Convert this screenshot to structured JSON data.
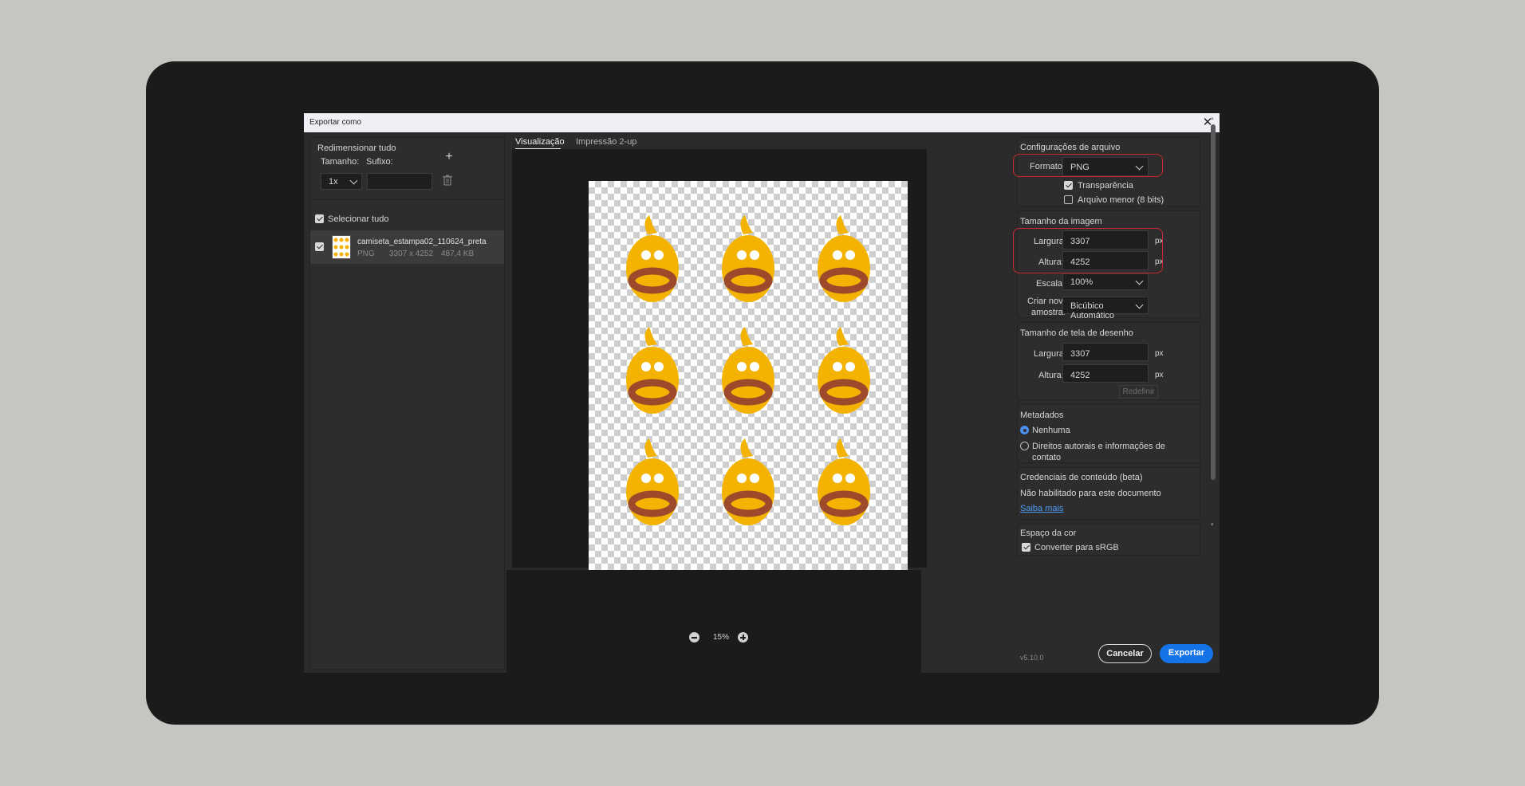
{
  "dialog": {
    "title": "Exportar como",
    "version": "v5.10.0"
  },
  "left": {
    "resize_all": "Redimensionar tudo",
    "size_label": "Tamanho:",
    "suffix_label": "Sufixo:",
    "size_value": "1x",
    "suffix_value": "",
    "select_all": "Selecionar tudo",
    "asset": {
      "name": "camiseta_estampa02_110624_preta",
      "format": "PNG",
      "dimensions": "3307 x 4252",
      "filesize": "487,4 KB"
    }
  },
  "center": {
    "tabs": [
      {
        "label": "Visualização",
        "active": true
      },
      {
        "label": "Impressão 2-up",
        "active": false
      }
    ],
    "zoom": "15%",
    "preview": {
      "mascot_color": "#f4b301",
      "mouth_color": "#9c4a2b",
      "cols": 3,
      "rows": 3
    }
  },
  "right": {
    "file_settings": {
      "heading": "Configurações de arquivo",
      "format_label": "Formato:",
      "format_value": "PNG",
      "transparency": "Transparência",
      "smaller_file": "Arquivo menor (8 bits)"
    },
    "image_size": {
      "heading": "Tamanho da imagem",
      "width_label": "Largura:",
      "width_value": "3307",
      "height_label": "Altura:",
      "height_value": "4252",
      "unit": "px",
      "scale_label": "Escala:",
      "scale_value": "100%",
      "resample_label_1": "Criar nova",
      "resample_label_2": "amostra:",
      "resample_value": "Bicúbico Automático"
    },
    "canvas_size": {
      "heading": "Tamanho de tela de desenho",
      "width_label": "Largura:",
      "width_value": "3307",
      "height_label": "Altura:",
      "height_value": "4252",
      "unit": "px",
      "reset": "Redefinir"
    },
    "metadata": {
      "heading": "Metadados",
      "option_none": "Nenhuma",
      "option_copyright_1": "Direitos autorais e informações de",
      "option_copyright_2": "contato"
    },
    "credentials": {
      "heading": "Credenciais de conteúdo (beta)",
      "status": "Não habilitado para este documento",
      "learn_more": "Saiba mais"
    },
    "color_space": {
      "heading": "Espaço da cor",
      "convert": "Converter para sRGB"
    }
  },
  "buttons": {
    "cancel": "Cancelar",
    "export": "Exportar"
  },
  "colors": {
    "accent": "#1473e6",
    "highlight": "#c9282f"
  }
}
